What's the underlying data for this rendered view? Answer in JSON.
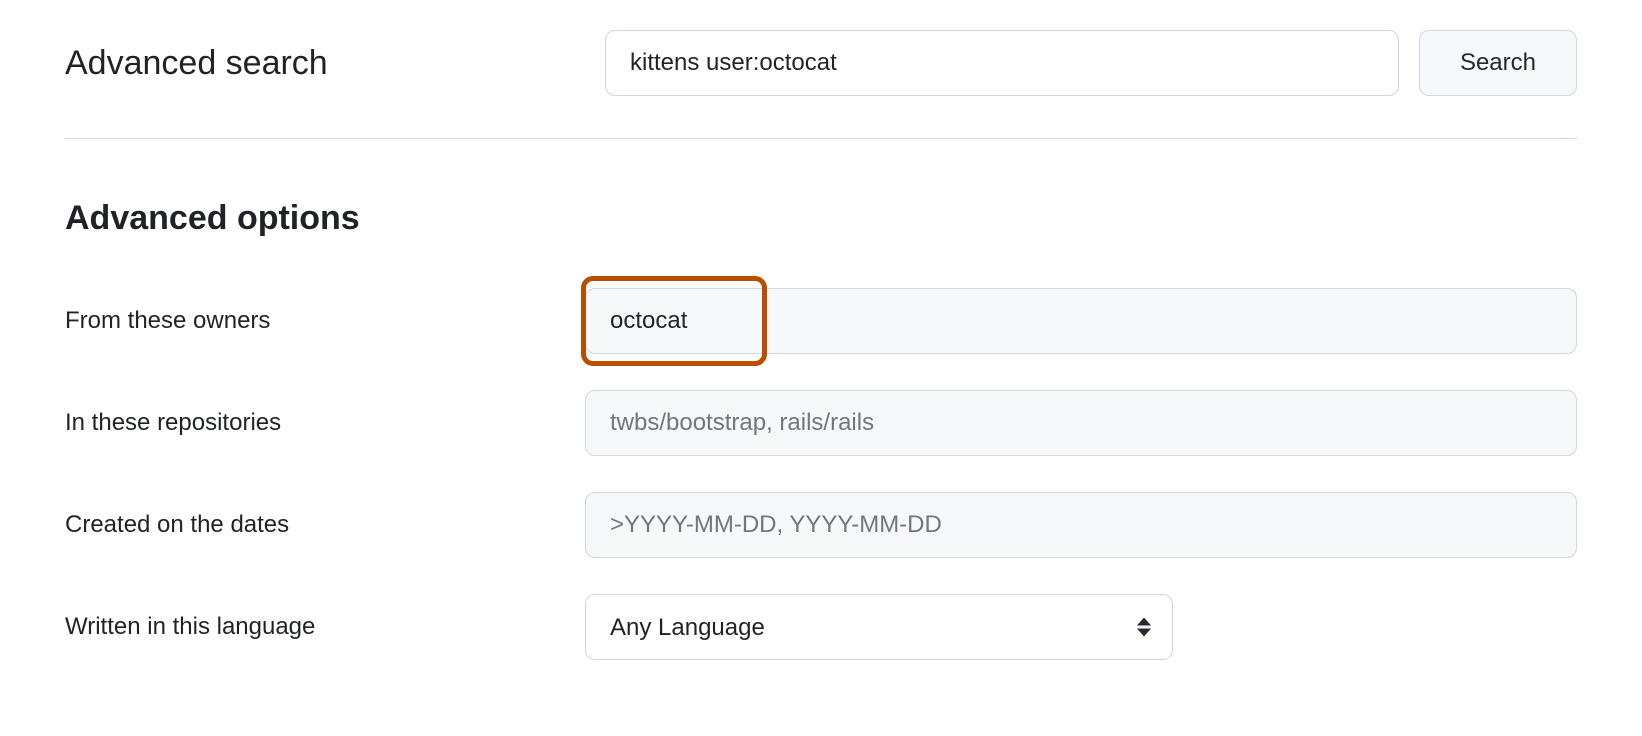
{
  "header": {
    "title": "Advanced search",
    "search_value": "kittens user:octocat",
    "search_button_label": "Search"
  },
  "options": {
    "section_title": "Advanced options",
    "fields": {
      "owners": {
        "label": "From these owners",
        "value": "octocat",
        "placeholder": ""
      },
      "repositories": {
        "label": "In these repositories",
        "value": "",
        "placeholder": "twbs/bootstrap, rails/rails"
      },
      "created": {
        "label": "Created on the dates",
        "value": "",
        "placeholder": ">YYYY-MM-DD, YYYY-MM-DD"
      },
      "language": {
        "label": "Written in this language",
        "selected": "Any Language"
      }
    }
  }
}
